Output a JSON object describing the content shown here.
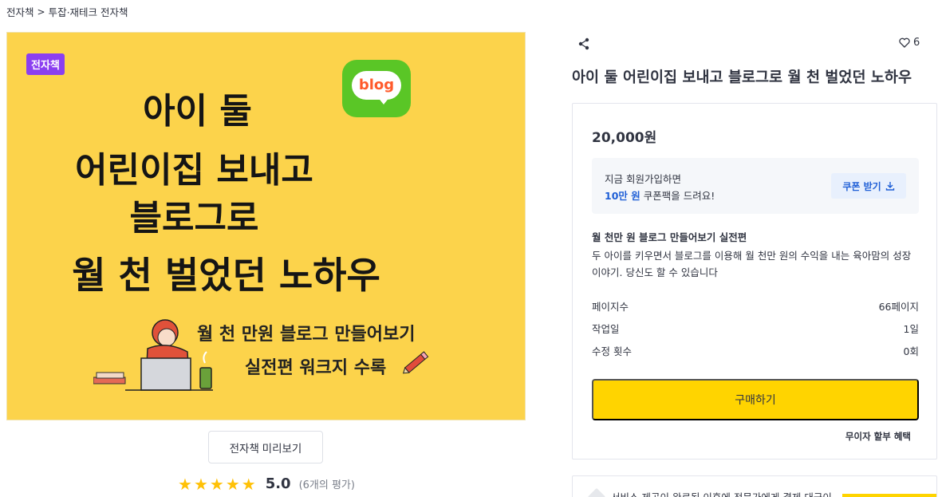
{
  "breadcrumb": {
    "root": "전자책",
    "separator": ">",
    "category": "투잡·재테크 전자책"
  },
  "thumbnail": {
    "badge": "전자책",
    "title_lines": [
      "아이 둘",
      "어린이집 보내고",
      "블로그로",
      "월 천 벌었던 노하우"
    ],
    "sub_lines": [
      "월 천 만원 블로그 만들어보기",
      "실전편 워크지 수록"
    ],
    "blog_icon_text": "blog",
    "bg_color": "#fcd34b"
  },
  "preview_button": "전자책 미리보기",
  "rating": {
    "stars": 5,
    "value": "5.0",
    "count": "(6개의 평가)"
  },
  "actions": {
    "share_icon": "share-icon",
    "like_icon": "heart-icon",
    "like_count": "6"
  },
  "product": {
    "title": "아이 둘 어린이집 보내고 블로그로 월 천 벌었던 노하우",
    "price": "20,000원",
    "coupon": {
      "line1": "지금 회원가입하면",
      "amount": "10만 원",
      "line2_rest": " 쿠폰팩을 드려요!",
      "button": "쿠폰 받기"
    },
    "desc_title": "월 천만 원 블로그 만들어보기 실전편",
    "desc_text": "두 아이를 키우면서 블로그를 이용해 월 천만 원의 수익을 내는 육아맘의 성장 이야기. 당신도 할 수 있습니다",
    "info": [
      {
        "label": "페이지수",
        "value": "66페이지"
      },
      {
        "label": "작업일",
        "value": "1일"
      },
      {
        "label": "수정 횟수",
        "value": "0회"
      }
    ],
    "buy_button": "구매하기",
    "installment": "무이자 할부 혜택",
    "accent_color": "#ffd400"
  },
  "bottom_notice": "서비스 제공이 완료된 이후에 전문가에게 결제 대금이"
}
